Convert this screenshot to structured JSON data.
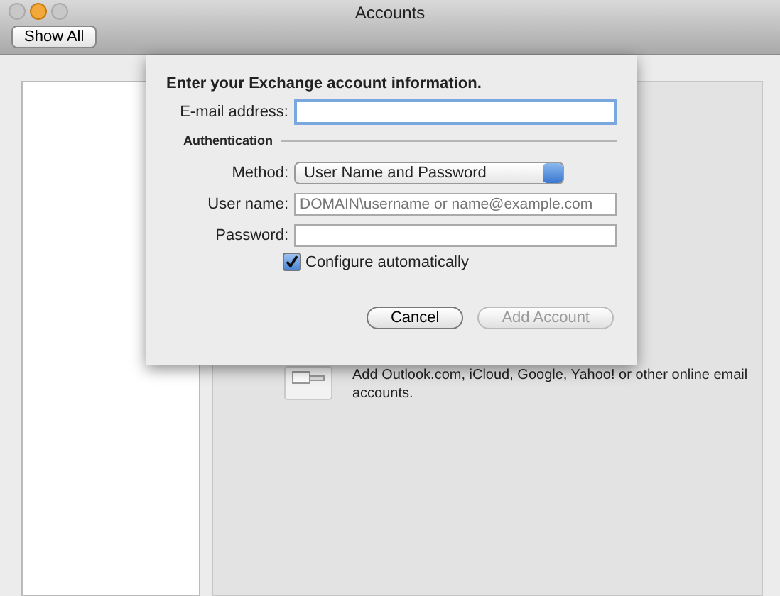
{
  "window": {
    "title": "Accounts"
  },
  "toolbar": {
    "show_all_button": "Show All"
  },
  "other_account": {
    "description": "Add Outlook.com, iCloud, Google, Yahoo! or other online email accounts."
  },
  "sheet": {
    "heading": "Enter your Exchange account information.",
    "email": {
      "label": "E-mail address:",
      "focused": true
    },
    "section": "Authentication",
    "method": {
      "label": "Method:",
      "value": "User Name and Password"
    },
    "username": {
      "label": "User name:",
      "placeholder": "DOMAIN\\username or name@example.com"
    },
    "password": {
      "label": "Password:"
    },
    "configure": {
      "label": "Configure automatically",
      "checked": true
    },
    "buttons": [
      {
        "label": "Cancel",
        "disabled": false
      },
      {
        "label": "Add Account",
        "disabled": true
      }
    ]
  }
}
